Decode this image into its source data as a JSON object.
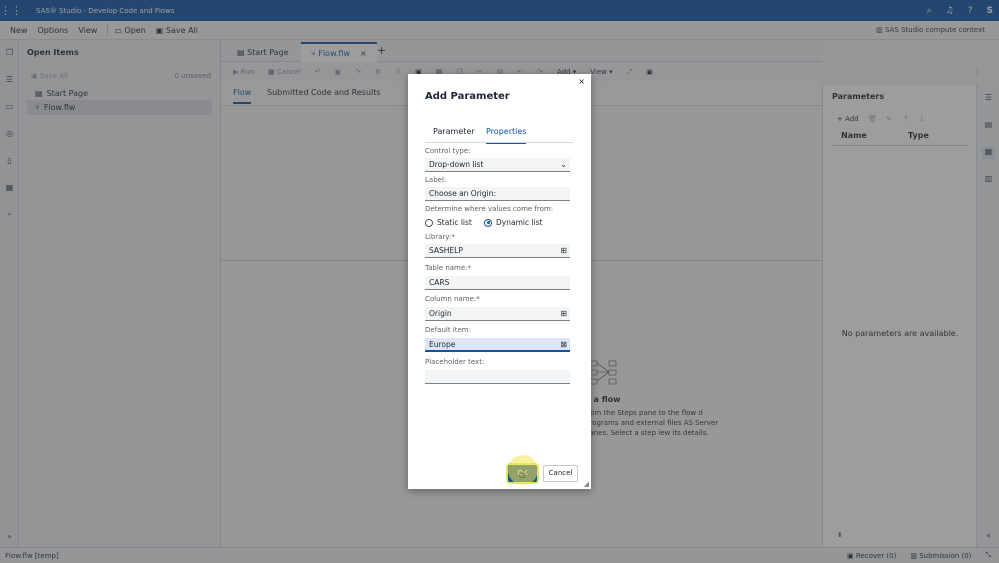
{
  "titlebar": {
    "title": "SAS® Studio - Develop Code and Flows",
    "user": "S"
  },
  "menubar": {
    "new": "New",
    "options": "Options",
    "view": "View",
    "open": "Open",
    "save_all": "Save All",
    "context": "SAS Studio compute context"
  },
  "open_items": {
    "title": "Open Items",
    "save_all": "Save All",
    "unsaved": "0 unsaved",
    "items": [
      {
        "label": "Start Page"
      },
      {
        "label": "Flow.flw"
      }
    ]
  },
  "tabs": [
    {
      "label": "Start Page"
    },
    {
      "label": "Flow.flw"
    }
  ],
  "toolbar": {
    "run": "Run",
    "cancel": "Cancel",
    "add": "Add",
    "view": "View"
  },
  "subtabs": {
    "flow": "Flow",
    "results": "Submitted Code and Results"
  },
  "canvas": {
    "empty_title": "d a flow",
    "empty_text": "from the Steps pane to the flow d programs and external files AS Server panes. Select a step iew its details."
  },
  "parameters": {
    "title": "Parameters",
    "add": "Add",
    "col_name": "Name",
    "col_type": "Type",
    "empty": "No parameters are available."
  },
  "status": {
    "left": "Flow.flw [temp]",
    "recover": "Recover (0)",
    "submission": "Submission (0)"
  },
  "dialog": {
    "title": "Add Parameter",
    "tab_parameter": "Parameter",
    "tab_properties": "Properties",
    "control_type_label": "Control type:",
    "control_type_value": "Drop-down list",
    "label_label": "Label:",
    "label_value": "Choose an Origin:",
    "values_from_label": "Determine where values come from:",
    "static_list": "Static list",
    "dynamic_list": "Dynamic list",
    "library_label": "Library:*",
    "library_value": "SASHELP",
    "table_label": "Table name:*",
    "table_value": "CARS",
    "column_label": "Column name:*",
    "column_value": "Origin",
    "default_label": "Default item:",
    "default_value": "Europe",
    "placeholder_label": "Placeholder text:",
    "placeholder_value": "",
    "ok": "OK",
    "cancel": "Cancel"
  }
}
